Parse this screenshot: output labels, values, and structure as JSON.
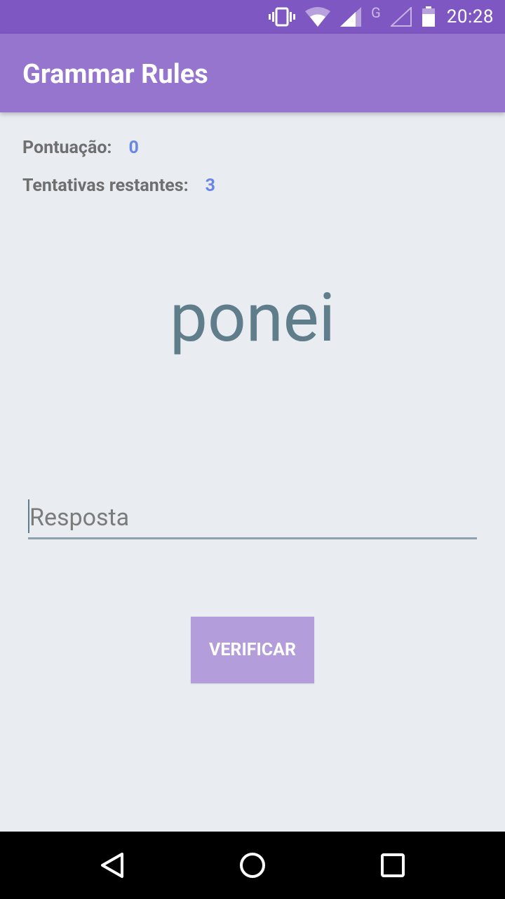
{
  "status_bar": {
    "time": "20:28",
    "icons": [
      "vibrate-icon",
      "wifi-icon",
      "signal-icon",
      "g-network-icon",
      "signal-empty-icon",
      "battery-icon"
    ],
    "network_label": "G"
  },
  "app_bar": {
    "title": "Grammar Rules"
  },
  "stats": {
    "score_label": "Pontuação:",
    "score_value": "0",
    "tries_label": "Tentativas restantes:",
    "tries_value": "3"
  },
  "word": "ponei",
  "answer": {
    "value": "",
    "placeholder": "Resposta"
  },
  "verify_button": {
    "label": "VERIFICAR"
  },
  "nav_bar": {
    "icons": [
      "back-icon",
      "home-icon",
      "recents-icon"
    ]
  },
  "colors": {
    "status_bar": "#7e57c2",
    "app_bar": "#9575cd",
    "background": "#e9edf1",
    "accent_value": "#6986e8",
    "word": "#607d8b",
    "button": "#b39ddb"
  }
}
